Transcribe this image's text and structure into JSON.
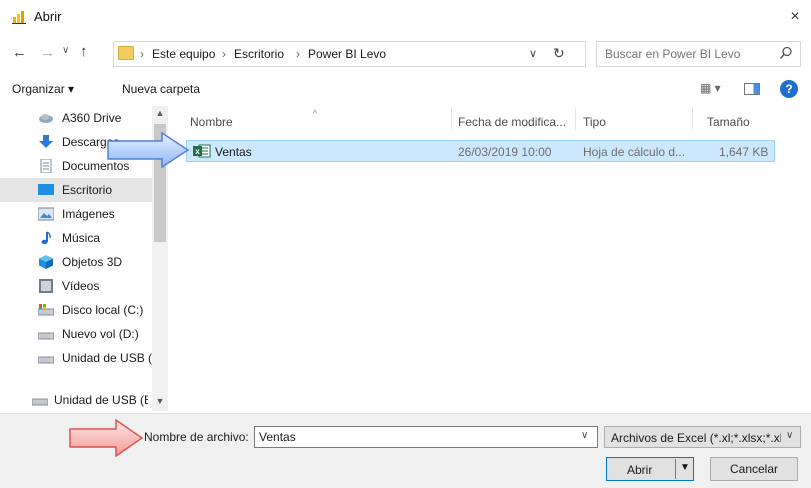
{
  "window": {
    "title": "Abrir",
    "close": "×"
  },
  "nav": {
    "back": "←",
    "forward": "→",
    "recent": "∨",
    "up": "↑"
  },
  "address": {
    "sep": "›",
    "crumbs": [
      "Este equipo",
      "Escritorio",
      "Power BI Levo"
    ],
    "dropdown": "∨",
    "refresh": "↻"
  },
  "search": {
    "placeholder": "Buscar en Power BI Levo"
  },
  "toolbar": {
    "organize": "Organizar ▾",
    "new_folder": "Nueva carpeta",
    "view": "▦ ▾",
    "help": "?"
  },
  "sidebar": {
    "scroll_up": "▲",
    "scroll_down": "▼",
    "items": [
      {
        "label": "A360 Drive",
        "icon": "cloud-icon"
      },
      {
        "label": "Descargas",
        "icon": "download-icon"
      },
      {
        "label": "Documentos",
        "icon": "document-icon"
      },
      {
        "label": "Escritorio",
        "icon": "desktop-icon"
      },
      {
        "label": "Imágenes",
        "icon": "pictures-icon"
      },
      {
        "label": "Música",
        "icon": "music-icon"
      },
      {
        "label": "Objetos 3D",
        "icon": "cube-icon"
      },
      {
        "label": "Vídeos",
        "icon": "video-icon"
      },
      {
        "label": "Disco local (C:)",
        "icon": "local-disk-icon"
      },
      {
        "label": "Nuevo vol (D:)",
        "icon": "drive-icon"
      },
      {
        "label": "Unidad de USB (",
        "icon": "usb-drive-icon"
      },
      {
        "label": "Unidad de USB (E:",
        "icon": "usb-drive-icon"
      }
    ],
    "selected": "Escritorio"
  },
  "file_list": {
    "columns": [
      "Nombre",
      "Fecha de modifica...",
      "Tipo",
      "Tamaño"
    ],
    "sort_indicator": "^",
    "rows": [
      {
        "name": "Ventas",
        "modified": "26/03/2019 10:00",
        "type": "Hoja de cálculo d...",
        "size": "1,647 KB",
        "icon": "excel-icon"
      }
    ]
  },
  "bottom": {
    "filename_label": "Nombre de archivo:",
    "filename_value": "Ventas",
    "filename_dropdown": "∨",
    "filetype": "Archivos de Excel (*.xl;*.xlsx;*.xl:",
    "filetype_arrow": "∨",
    "open": "Abrir",
    "open_arrow": "▼",
    "cancel": "Cancelar"
  },
  "colors": {
    "selection_bg": "#cce8ff",
    "accent": "#0078d7",
    "folder": "#f2cc5e"
  }
}
